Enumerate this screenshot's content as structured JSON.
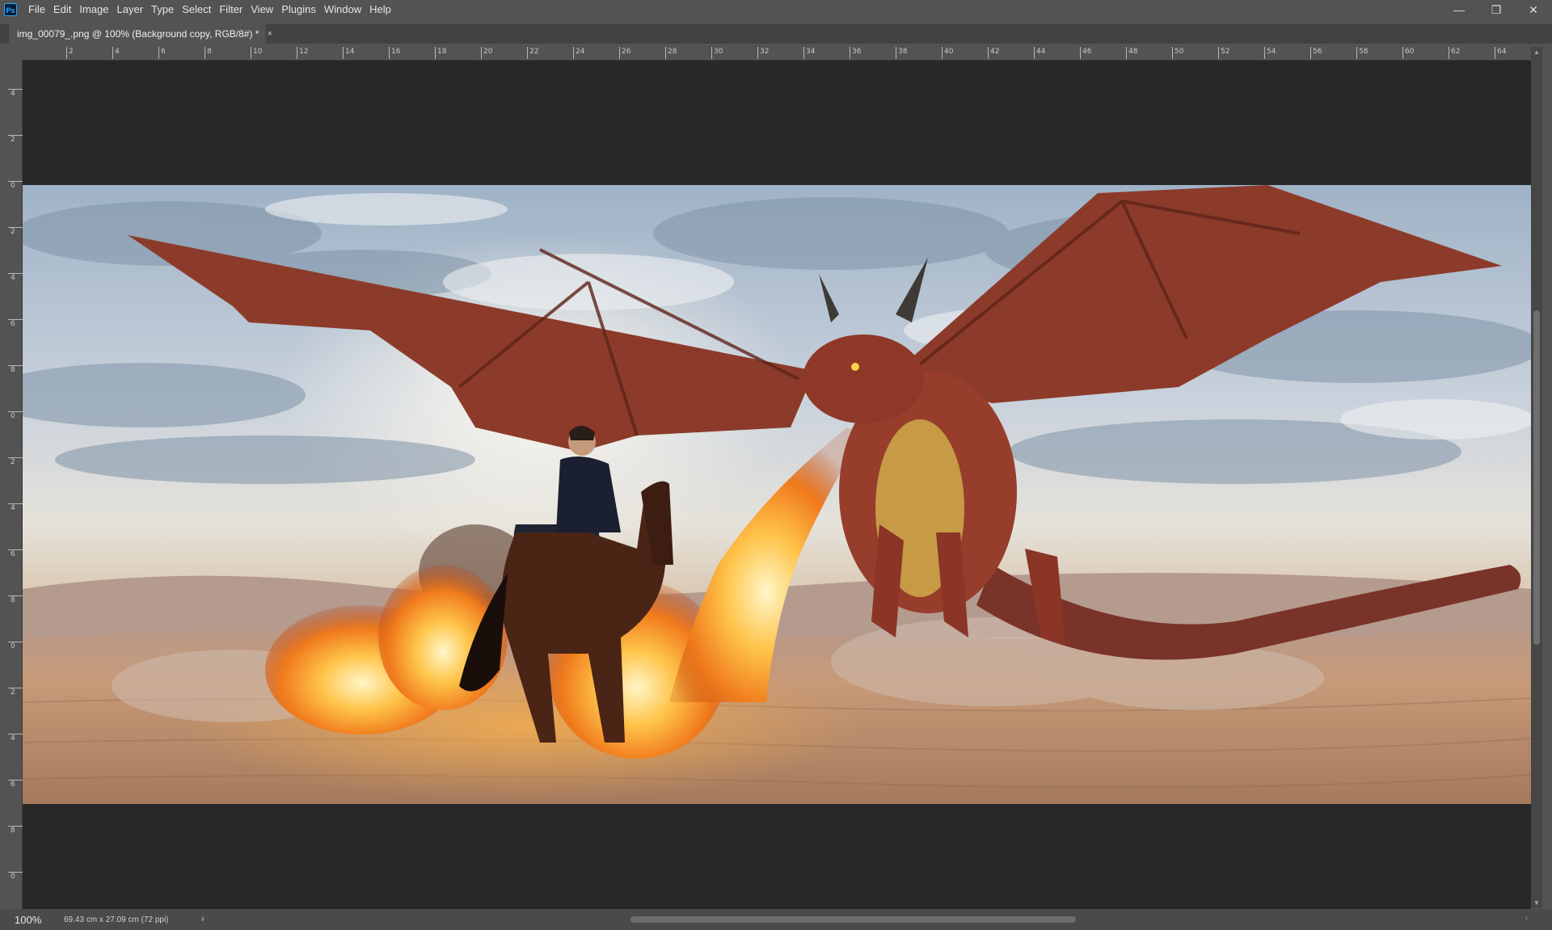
{
  "app": {
    "logo_text": "Ps"
  },
  "menu": {
    "items": [
      "File",
      "Edit",
      "Image",
      "Layer",
      "Type",
      "Select",
      "Filter",
      "View",
      "Plugins",
      "Window",
      "Help"
    ]
  },
  "window_controls": {
    "minimize": "—",
    "restore": "❐",
    "close": "✕"
  },
  "document_tab": {
    "title": "img_00079_.png @ 100% (Background copy, RGB/8#) *",
    "close": "×"
  },
  "ruler_top": {
    "labels": [
      "2",
      "4",
      "6",
      "8",
      "10",
      "12",
      "14",
      "16",
      "18",
      "20",
      "22",
      "24",
      "26",
      "28",
      "30",
      "32",
      "34",
      "36",
      "38",
      "40",
      "42",
      "44",
      "46",
      "48",
      "50",
      "52",
      "54",
      "56",
      "58",
      "60",
      "62",
      "64"
    ]
  },
  "ruler_left": {
    "labels": [
      "4",
      "2",
      "0",
      "2",
      "4",
      "6",
      "8",
      "0",
      "2",
      "4",
      "6",
      "8",
      "0",
      "2",
      "4",
      "6",
      "8",
      "0"
    ]
  },
  "canvas": {
    "background_color": "#282828",
    "image_description_icon": "image-layer"
  },
  "status": {
    "zoom": "100%",
    "doc_info": "69.43 cm x 27.09 cm (72 ppi)",
    "expand_arrow": "›",
    "scroll_left_arrow": "‹",
    "scroll_right_arrow": "›"
  },
  "colors": {
    "ui_background": "#535353",
    "tab_bar": "#424242",
    "canvas_pasteboard": "#282828",
    "accent_ps": "#31a8ff"
  }
}
